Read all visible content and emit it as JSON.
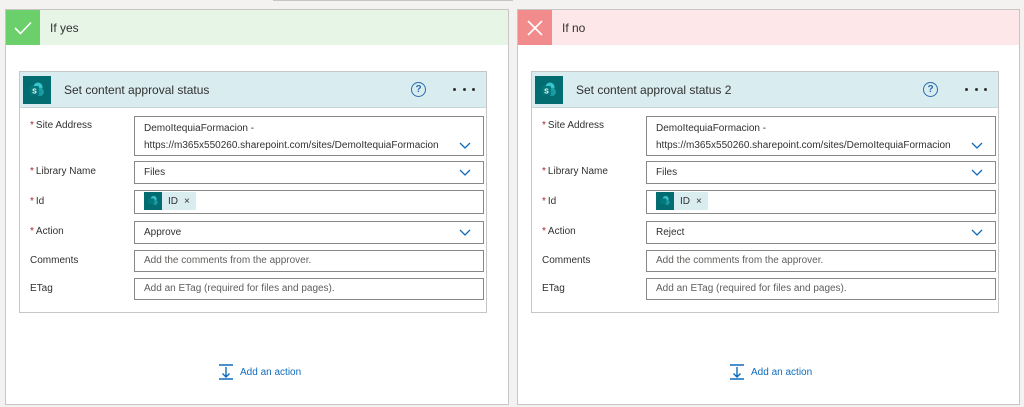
{
  "branches": {
    "yes": {
      "title": "If yes",
      "card": {
        "title": "Set content approval status",
        "help": "?",
        "fields": {
          "site_address": {
            "label": "Site Address",
            "value_line1": "DemoItequiaFormacion -",
            "value_line2": "https://m365x550260.sharepoint.com/sites/DemoItequiaFormacion"
          },
          "library_name": {
            "label": "Library Name",
            "value": "Files"
          },
          "id": {
            "label": "Id",
            "token": "ID",
            "token_remove": "×"
          },
          "action": {
            "label": "Action",
            "value": "Approve"
          },
          "comments": {
            "label": "Comments",
            "placeholder": "Add the comments from the approver."
          },
          "etag": {
            "label": "ETag",
            "placeholder": "Add an ETag (required for files and pages)."
          }
        }
      },
      "add_action": "Add an action"
    },
    "no": {
      "title": "If no",
      "card": {
        "title": "Set content approval status 2",
        "help": "?",
        "fields": {
          "site_address": {
            "label": "Site Address",
            "value_line1": "DemoItequiaFormacion -",
            "value_line2": "https://m365x550260.sharepoint.com/sites/DemoItequiaFormacion"
          },
          "library_name": {
            "label": "Library Name",
            "value": "Files"
          },
          "id": {
            "label": "Id",
            "token": "ID",
            "token_remove": "×"
          },
          "action": {
            "label": "Action",
            "value": "Reject"
          },
          "comments": {
            "label": "Comments",
            "placeholder": "Add the comments from the approver."
          },
          "etag": {
            "label": "ETag",
            "placeholder": "Add an ETag (required for files and pages)."
          }
        }
      },
      "add_action": "Add an action"
    }
  },
  "required_mark": "*",
  "colors": {
    "yes_header": "#e7f5e7",
    "yes_icon": "#6bd06b",
    "no_header": "#fde7e9",
    "no_icon": "#f28c8c",
    "card_header": "#d9ecef",
    "sharepoint": "#036c70",
    "link_blue": "#0f6cbd"
  },
  "icons": {
    "yes": "checkmark-icon",
    "no": "close-icon",
    "connector": "sharepoint-icon",
    "help": "help-icon",
    "more": "more-options-icon",
    "dropdown": "chevron-down-icon",
    "add_action": "add-action-icon"
  }
}
